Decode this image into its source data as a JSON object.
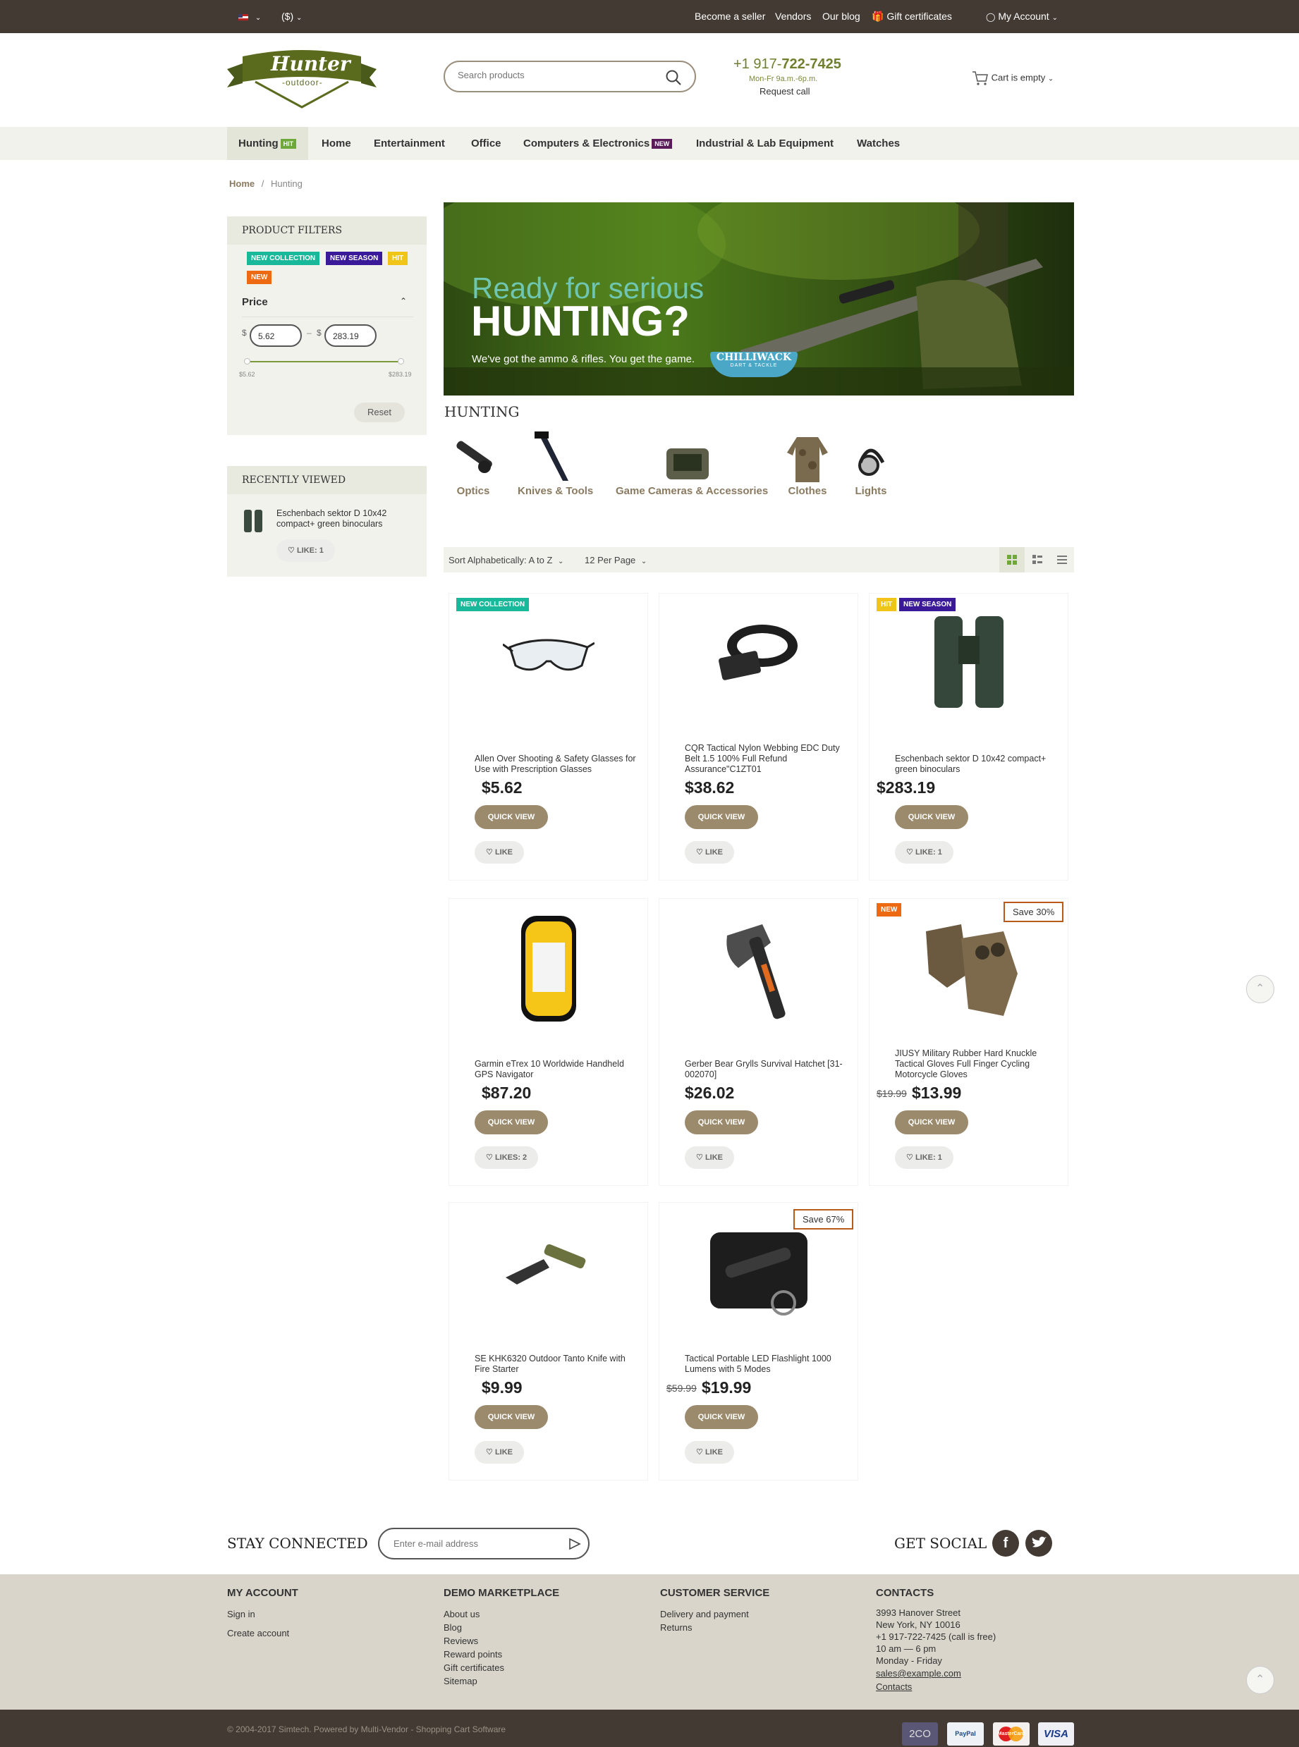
{
  "topbar": {
    "flag": "flag-us-icon",
    "currency": "($)",
    "links": [
      "Become a seller",
      "Vendors",
      "Our blog",
      "Gift certificates"
    ],
    "account": "My Account"
  },
  "header": {
    "logo_main": "Hunter",
    "logo_sub": "-outdoor-",
    "search_placeholder": "Search products",
    "phone_prefix": "+1 917-",
    "phone_main": "722-7425",
    "hours": "Mon-Fr 9a.m.-6p.m.",
    "request_call": "Request call",
    "cart": "Cart is empty"
  },
  "nav": {
    "items": [
      "Hunting",
      "Home",
      "Entertainment",
      "Office",
      "Computers & Electronics",
      "Industrial & Lab Equipment",
      "Watches"
    ],
    "hunting_badge": "HIT",
    "computers_badge": "NEW"
  },
  "breadcrumb": {
    "home": "Home",
    "sep": "/",
    "current": "Hunting"
  },
  "filters": {
    "title": "PRODUCT FILTERS",
    "tags": [
      "NEW COLLECTION",
      "NEW SEASON",
      "HIT",
      "NEW"
    ],
    "price_label": "Price",
    "currency": "$",
    "dash": "–",
    "min": "5.62",
    "max": "283.19",
    "min_label": "$5.62",
    "max_label": "$283.19",
    "reset": "Reset"
  },
  "recent": {
    "title": "RECENTLY VIEWED",
    "item": "Eschenbach sektor D 10x42 compact+ green binoculars",
    "like": "LIKE: 1"
  },
  "banner": {
    "line1": "Ready for serious",
    "line2": "HUNTING?",
    "line3": "We've got the ammo & rifles. You get the game.",
    "brand": "CHILLIWACK",
    "brand_sub": "DART & TACKLE"
  },
  "category": {
    "title": "HUNTING",
    "subcats": [
      "Optics",
      "Knives & Tools",
      "Game Cameras & Accessories",
      "Clothes",
      "Lights"
    ]
  },
  "sort": {
    "sort_label": "Sort Alphabetically: A to Z",
    "per_page": "12 Per Page"
  },
  "common": {
    "quick_view": "QUICK VIEW"
  },
  "products": [
    {
      "name": "Allen Over Shooting & Safety Glasses for Use with Prescription Glasses",
      "price": "$5.62",
      "like": "LIKE",
      "tags": [
        "NEW COLLECTION"
      ]
    },
    {
      "name": "CQR Tactical Nylon Webbing EDC Duty Belt 1.5 100% Full Refund Assurance\"C1ZT01",
      "price": "$38.62",
      "like": "LIKE",
      "tags": []
    },
    {
      "name": "Eschenbach sektor D 10x42 compact+ green binoculars",
      "price": "$283.19",
      "like": "LIKE: 1",
      "tags": [
        "HIT",
        "NEW SEASON"
      ]
    },
    {
      "name": "Garmin eTrex 10 Worldwide Handheld GPS Navigator",
      "price": "$87.20",
      "like": "LIKES: 2",
      "tags": []
    },
    {
      "name": "Gerber Bear Grylls Survival Hatchet [31-002070]",
      "price": "$26.02",
      "like": "LIKE",
      "tags": []
    },
    {
      "name": "JIUSY Military Rubber Hard Knuckle Tactical Gloves Full Finger Cycling Motorcycle Gloves",
      "price": "$13.99",
      "old_price": "$19.99",
      "like": "LIKE: 1",
      "tags": [
        "NEW"
      ],
      "save": "Save 30%"
    },
    {
      "name": "SE KHK6320 Outdoor Tanto Knife with Fire Starter",
      "price": "$9.99",
      "like": "LIKE",
      "tags": []
    },
    {
      "name": "Tactical Portable LED Flashlight 1000 Lumens with 5 Modes",
      "price": "$19.99",
      "old_price": "$59.99",
      "like": "LIKE",
      "tags": [],
      "save": "Save 67%"
    }
  ],
  "newsletter": {
    "title": "STAY CONNECTED",
    "placeholder": "Enter e-mail address"
  },
  "social": {
    "title": "GET SOCIAL"
  },
  "footer": {
    "account": {
      "title": "MY ACCOUNT",
      "links": [
        "Sign in",
        "Create account"
      ]
    },
    "marketplace": {
      "title": "DEMO MARKETPLACE",
      "links": [
        "About us",
        "Blog",
        "Reviews",
        "Reward points",
        "Gift certificates",
        "Sitemap"
      ]
    },
    "service": {
      "title": "CUSTOMER SERVICE",
      "links": [
        "Delivery and payment",
        "Returns"
      ]
    },
    "contacts": {
      "title": "CONTACTS",
      "lines": [
        "3993 Hanover Street",
        "New York, NY 10016",
        "+1 917-722-7425 (call is free)",
        "10 am — 6 pm",
        "Monday - Friday",
        "sales@example.com",
        "Contacts"
      ]
    }
  },
  "copyright": "© 2004-2017 Simtech.  Powered by Multi-Vendor - Shopping Cart Software",
  "payments": [
    "2CO",
    "PayPal",
    "MasterCard",
    "VISA"
  ],
  "colors": {
    "topbar": "#433a33",
    "accent_green": "#6f7f2e",
    "button_brown": "#9b8a6c",
    "panel_bg": "#f1f2ec",
    "footer_bg": "#d9d5cb"
  }
}
